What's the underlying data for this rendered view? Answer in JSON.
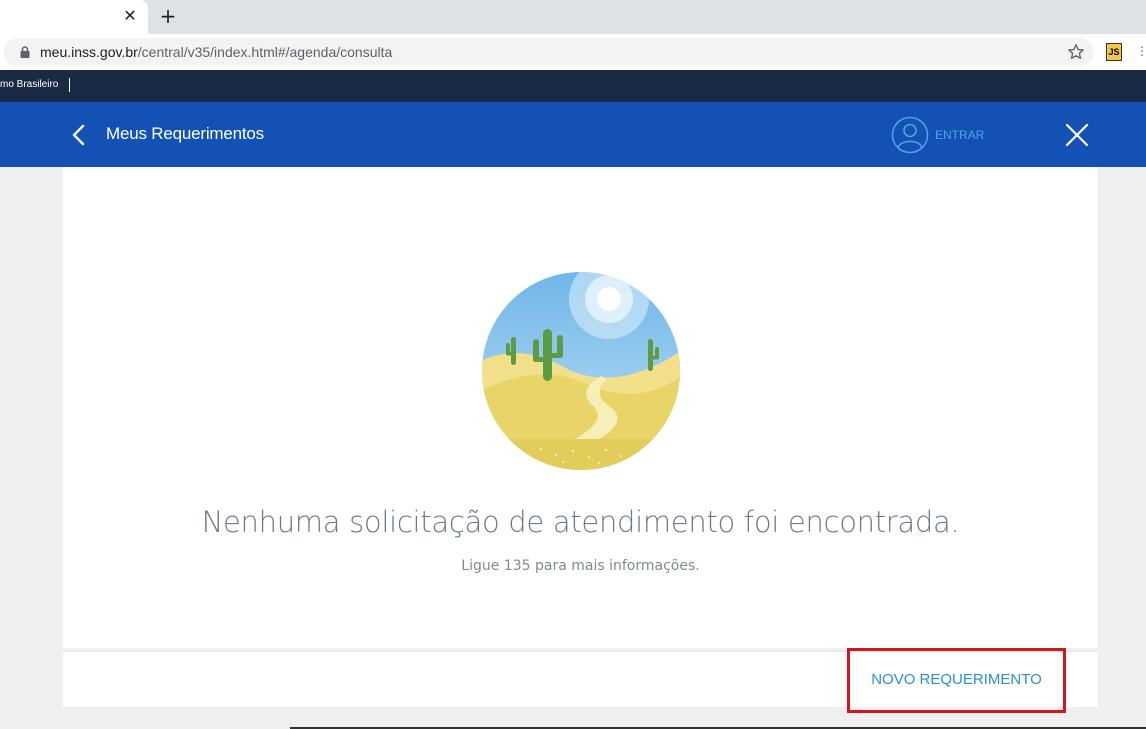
{
  "browser": {
    "tab_close": "✕",
    "new_tab": "+",
    "url_host": "meu.inss.gov.br",
    "url_path": "/central/v35/index.html#/agenda/consulta",
    "extension_label": "JS"
  },
  "govbar": {
    "text": "mo Brasileiro"
  },
  "header": {
    "title": "Meus Requerimentos",
    "login_label": "ENTRAR"
  },
  "main": {
    "empty_title": "Nenhuma solicitação de atendimento foi encontrada.",
    "empty_subtitle": "Ligue 135 para mais informações."
  },
  "footer": {
    "new_request_label": "NOVO REQUERIMENTO"
  },
  "colors": {
    "header_bg": "#1351b4",
    "govbar_bg": "#1a2a44",
    "highlight_border": "#d0161e",
    "link": "#2b8fd6"
  }
}
